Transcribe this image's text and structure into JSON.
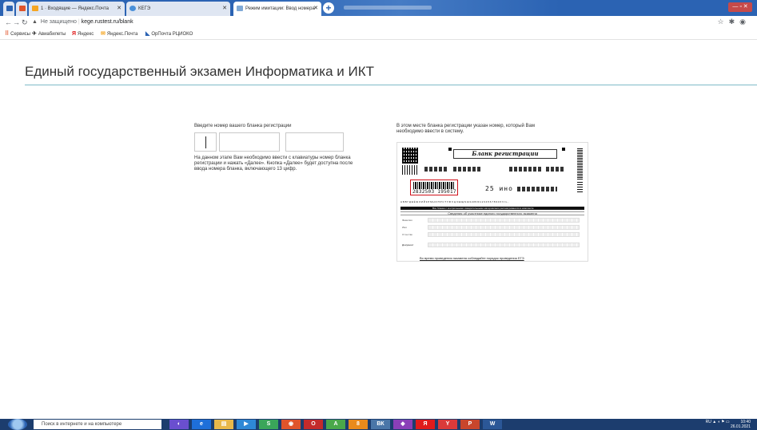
{
  "browser": {
    "tabs": [
      {
        "label": "1 · Входящие — Яндекс.Почта",
        "active": false
      },
      {
        "label": "КЕГЭ",
        "active": false
      },
      {
        "label": "Режим имитации: Ввод номера",
        "active": true
      }
    ],
    "address": {
      "security_label": "Не защищено",
      "url": "kege.rustest.ru/blank"
    },
    "bookmarks": [
      {
        "label": "Сервисы",
        "icon": "apps-icon"
      },
      {
        "label": "Авиабилеты",
        "icon": "plane-icon"
      },
      {
        "label": "Яндекс",
        "icon": "yandex-icon"
      },
      {
        "label": "Яндекс.Почта",
        "icon": "mail-icon"
      },
      {
        "label": "ОрПочта РЦИОКО",
        "icon": "flag-icon"
      }
    ]
  },
  "page": {
    "title": "Единый государственный экзамен Информатика и ИКТ",
    "left": {
      "label": "Введите номер вашего бланка регистрации",
      "helper": "На данном этапе Вам необходимо ввести с клавиатуры номер бланка регистрации и нажать «Далее». Кнопка «Далее» будет доступна после ввода номера бланка, включающего 13 цифр."
    },
    "right": {
      "label": "В этом месте бланка регистрации указан номер, который Вам необходимо ввести в систему.",
      "form": {
        "title": "Бланк регистрации",
        "barcode_number": "2832503 195017",
        "region_code": "25 ино",
        "alphabet": "А Б В Г Д Е Ё Ж З И Й К Л М Н О П Р С Т У Ф Х Ц Ч Ш Щ Ъ Ы Ь Э Ю Я 1 2 3 4 5 6 7 8 9 0 X V I L -",
        "strip_text": "Все бланки с контрольными измерительными материалами рассматриваются в комплекте",
        "section_title": "Сведения об участнике единого государственного экзамена",
        "fields": [
          "Фамилия",
          "Имя",
          "Отчество",
          "Документ"
        ],
        "footer": "Во время проведения экзамена соблюдайте порядок проведения ЕГЭ"
      }
    }
  },
  "taskbar": {
    "search_placeholder": "Поиск в интернете и на компьютере",
    "tray_lang": "RU",
    "tray_time": "10:40",
    "tray_date": "26.01.2021"
  }
}
